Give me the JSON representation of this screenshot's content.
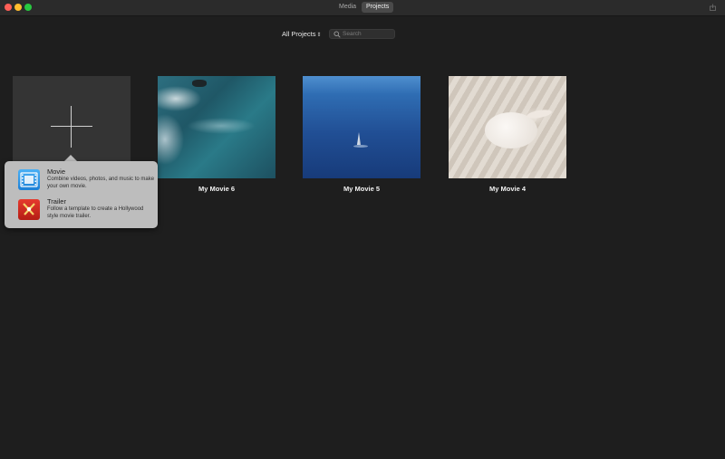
{
  "window": {
    "tabs": [
      {
        "label": "Media",
        "selected": false
      },
      {
        "label": "Projects",
        "selected": true
      }
    ]
  },
  "toolbar": {
    "filter_label": "All Projects",
    "search_placeholder": "Search",
    "search_value": ""
  },
  "projects": [
    {
      "title": "My Movie 6"
    },
    {
      "title": "My Movie 5"
    },
    {
      "title": "My Movie 4"
    }
  ],
  "new_project_menu": {
    "options": [
      {
        "title": "Movie",
        "description": "Combine videos, photos, and music to make your own movie.",
        "icon": "film-icon"
      },
      {
        "title": "Trailer",
        "description": "Follow a template to create a Hollywood style movie trailer.",
        "icon": "trailer-clapper-icon"
      }
    ]
  },
  "colors": {
    "background": "#1e1e1e",
    "popover": "#bdbdbd",
    "movie_icon": "#2a93e8",
    "trailer_icon": "#d42d22"
  }
}
